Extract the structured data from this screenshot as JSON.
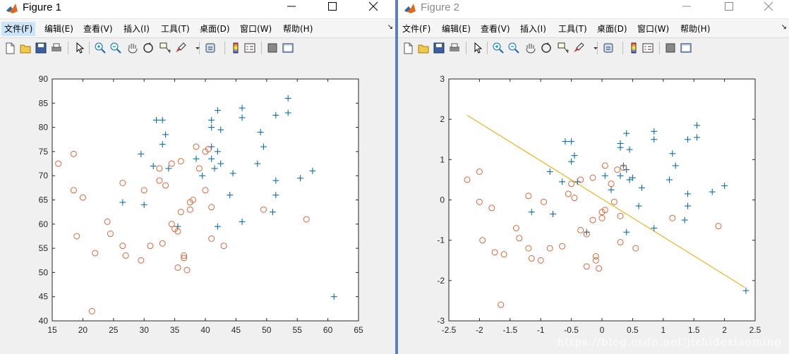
{
  "windows": [
    {
      "title": "Figure 1",
      "menu": [
        "文件(F)",
        "编辑(E)",
        "查看(V)",
        "插入(I)",
        "工具(T)",
        "桌面(D)",
        "窗口(W)",
        "帮助(H)"
      ],
      "active_menu": 0
    },
    {
      "title": "Figure 2",
      "menu": [
        "文件(F)",
        "编辑(E)",
        "查看(V)",
        "插入(I)",
        "工具(T)",
        "桌面(D)",
        "窗口(W)",
        "帮助(H)"
      ],
      "active_menu": -1
    }
  ],
  "toolbar_icons": [
    "new-figure-icon",
    "open-file-icon",
    "save-icon",
    "print-icon",
    "edit-plot-arrow-icon",
    "zoom-in-icon",
    "zoom-out-icon",
    "pan-hand-icon",
    "rotate-3d-icon",
    "data-cursor-icon",
    "brush-icon",
    "brush-dropdown-icon",
    "link-plot-icon",
    "insert-colorbar-icon",
    "insert-legend-icon",
    "hide-plot-tools-icon",
    "show-plot-tools-icon"
  ],
  "watermark": "https://blog.csdn.net/jizhidexiaoming",
  "colors": {
    "pos": "#0e6ea8",
    "neg": "#d9673a",
    "line": "#e8b424"
  },
  "chart_data": [
    {
      "type": "scatter",
      "xlim": [
        15,
        65
      ],
      "ylim": [
        40,
        90
      ],
      "xticks": [
        15,
        20,
        25,
        30,
        35,
        40,
        45,
        50,
        55,
        60,
        65
      ],
      "yticks": [
        40,
        45,
        50,
        55,
        60,
        65,
        70,
        75,
        80,
        85,
        90
      ],
      "series": [
        {
          "marker": "plus",
          "points": [
            [
              29.5,
              74.5
            ],
            [
              30,
              64
            ],
            [
              31.5,
              72
            ],
            [
              32,
              81.5
            ],
            [
              33,
              81.5
            ],
            [
              33,
              76.5
            ],
            [
              33.5,
              78.5
            ],
            [
              34,
              71.5
            ],
            [
              26.5,
              64.5
            ],
            [
              35.5,
              59.5
            ],
            [
              38.5,
              73.5
            ],
            [
              39.5,
              70
            ],
            [
              41,
              81.5
            ],
            [
              41,
              80
            ],
            [
              41,
              76
            ],
            [
              41,
              73.5
            ],
            [
              41.5,
              71.5
            ],
            [
              42,
              83.5
            ],
            [
              42,
              75
            ],
            [
              42.5,
              79.5
            ],
            [
              42.5,
              72.5
            ],
            [
              42,
              59.5
            ],
            [
              44,
              66
            ],
            [
              44.5,
              70.5
            ],
            [
              46,
              84
            ],
            [
              46,
              82
            ],
            [
              46,
              60.5
            ],
            [
              48.5,
              72.5
            ],
            [
              49,
              79
            ],
            [
              49.5,
              76
            ],
            [
              51,
              62.5
            ],
            [
              51.5,
              82.5
            ],
            [
              51.5,
              69
            ],
            [
              51.5,
              66
            ],
            [
              53.5,
              86
            ],
            [
              53.5,
              83
            ],
            [
              55.5,
              69.5
            ],
            [
              57.5,
              71
            ],
            [
              61,
              45
            ]
          ]
        },
        {
          "marker": "circle",
          "points": [
            [
              16,
              72.5
            ],
            [
              18.5,
              74.5
            ],
            [
              18.5,
              67
            ],
            [
              19,
              57.5
            ],
            [
              20,
              65.5
            ],
            [
              21.5,
              42
            ],
            [
              22,
              54
            ],
            [
              24,
              60.5
            ],
            [
              24.5,
              58
            ],
            [
              26.5,
              68.5
            ],
            [
              26.5,
              55.5
            ],
            [
              27,
              53.5
            ],
            [
              29.5,
              52.5
            ],
            [
              30,
              67
            ],
            [
              31,
              55.5
            ],
            [
              32.5,
              71.5
            ],
            [
              32.5,
              69
            ],
            [
              33,
              56
            ],
            [
              33.5,
              68
            ],
            [
              34.5,
              72.5
            ],
            [
              34.5,
              60
            ],
            [
              35,
              59
            ],
            [
              35.5,
              58.5
            ],
            [
              35.5,
              51
            ],
            [
              36,
              73
            ],
            [
              36,
              62.5
            ],
            [
              36.5,
              53.5
            ],
            [
              36.5,
              53
            ],
            [
              37,
              50.5
            ],
            [
              37.5,
              64.5
            ],
            [
              37.5,
              63
            ],
            [
              38,
              65
            ],
            [
              38.5,
              76
            ],
            [
              39,
              71.5
            ],
            [
              40,
              75
            ],
            [
              40,
              67
            ],
            [
              40.5,
              75.5
            ],
            [
              41,
              63.5
            ],
            [
              41,
              57
            ],
            [
              43,
              55.5
            ],
            [
              49.5,
              63
            ],
            [
              56.5,
              61
            ]
          ]
        }
      ]
    },
    {
      "type": "scatter",
      "xlim": [
        -2.5,
        2.5
      ],
      "ylim": [
        -3,
        3
      ],
      "xticks": [
        -2.5,
        -2,
        -1.5,
        -1,
        -0.5,
        0,
        0.5,
        1,
        1.5,
        2,
        2.5
      ],
      "yticks": [
        -3,
        -2,
        -1,
        0,
        1,
        2,
        3
      ],
      "line": [
        [
          -2.2,
          2.1
        ],
        [
          2.33,
          -2.17
        ]
      ],
      "series": [
        {
          "marker": "plus",
          "points": [
            [
              -0.6,
              1.45
            ],
            [
              -0.5,
              1.45
            ],
            [
              -0.45,
              1.1
            ],
            [
              -0.5,
              0.95
            ],
            [
              -0.85,
              0.7
            ],
            [
              -0.65,
              0.45
            ],
            [
              -0.4,
              0.45
            ],
            [
              -1.15,
              -0.3
            ],
            [
              -0.8,
              -0.35
            ],
            [
              -0.25,
              -0.8
            ],
            [
              0.05,
              0.6
            ],
            [
              0.15,
              0.25
            ],
            [
              0.3,
              0.6
            ],
            [
              0.3,
              1.3
            ],
            [
              0.3,
              1.4
            ],
            [
              0.35,
              0.85
            ],
            [
              0.4,
              0.75
            ],
            [
              0.4,
              1.65
            ],
            [
              0.45,
              1.25
            ],
            [
              0.4,
              -0.8
            ],
            [
              0.45,
              0.5
            ],
            [
              0.65,
              0.3
            ],
            [
              0.6,
              -0.15
            ],
            [
              0.85,
              1.7
            ],
            [
              0.85,
              1.5
            ],
            [
              0.85,
              -0.7
            ],
            [
              1.1,
              0.5
            ],
            [
              1.15,
              1.15
            ],
            [
              1.2,
              0.85
            ],
            [
              1.35,
              -0.5
            ],
            [
              1.4,
              1.5
            ],
            [
              1.4,
              0.15
            ],
            [
              1.4,
              -0.15
            ],
            [
              1.55,
              1.85
            ],
            [
              1.55,
              1.55
            ],
            [
              1.8,
              0.2
            ],
            [
              2,
              0.35
            ],
            [
              2.35,
              -2.25
            ],
            [
              0.5,
              0.55
            ]
          ]
        },
        {
          "marker": "circle",
          "points": [
            [
              -2.2,
              0.5
            ],
            [
              -2,
              0.7
            ],
            [
              -2,
              -0.05
            ],
            [
              -1.95,
              -1
            ],
            [
              -1.8,
              -0.2
            ],
            [
              -1.65,
              -2.6
            ],
            [
              -1.6,
              -1.35
            ],
            [
              -1.4,
              -0.7
            ],
            [
              -1.35,
              -0.95
            ],
            [
              -1.2,
              0.1
            ],
            [
              -1.2,
              -1.2
            ],
            [
              -1.15,
              -1.45
            ],
            [
              -1.0,
              -1.5
            ],
            [
              -0.95,
              -0.05
            ],
            [
              -0.85,
              -1.2
            ],
            [
              -0.65,
              -1.15
            ],
            [
              -0.55,
              0.15
            ],
            [
              -0.5,
              0.4
            ],
            [
              -0.45,
              0.05
            ],
            [
              -0.35,
              -0.75
            ],
            [
              -0.35,
              0.5
            ],
            [
              -0.25,
              -0.85
            ],
            [
              -0.25,
              -1.65
            ],
            [
              -0.15,
              -0.5
            ],
            [
              -0.15,
              0.55
            ],
            [
              -0.1,
              -1.4
            ],
            [
              -0.1,
              -1.5
            ],
            [
              -0.05,
              -1.7
            ],
            [
              0,
              -0.3
            ],
            [
              0,
              -0.45
            ],
            [
              0.05,
              -0.25
            ],
            [
              0.05,
              0.85
            ],
            [
              0.15,
              0.4
            ],
            [
              0.25,
              0.75
            ],
            [
              0.2,
              -0.05
            ],
            [
              0.3,
              -0.4
            ],
            [
              0.3,
              -1.05
            ],
            [
              0.35,
              0.8
            ],
            [
              0.55,
              -1.2
            ],
            [
              1.15,
              -0.45
            ],
            [
              1.9,
              -0.65
            ],
            [
              -1.75,
              -1.3
            ]
          ]
        }
      ]
    }
  ]
}
